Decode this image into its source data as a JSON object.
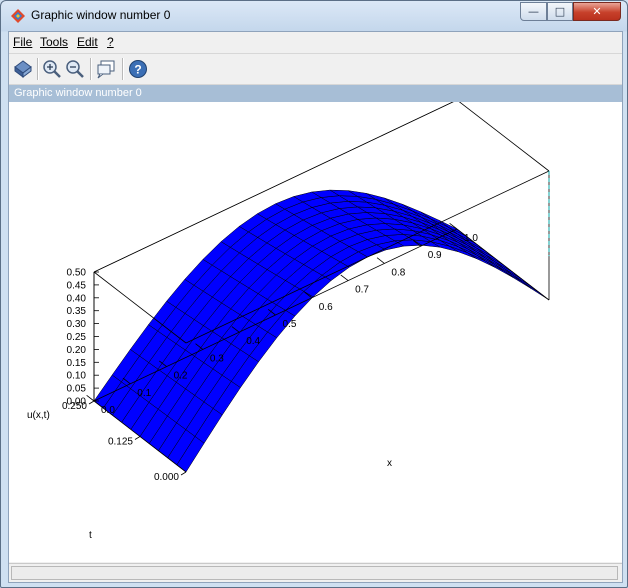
{
  "window": {
    "title": "Graphic window number 0",
    "controls": {
      "minimize": "—",
      "maximize": "□",
      "close": "✕"
    }
  },
  "menu": {
    "file": "File",
    "tools": "Tools",
    "edit": "Edit",
    "help": "?"
  },
  "toolbar": {
    "icons": [
      "rotate-icon",
      "zoom-in-icon",
      "zoom-out-icon",
      "datatip-icon",
      "help-icon"
    ]
  },
  "infobar": {
    "text": "Graphic window number 0"
  },
  "plot": {
    "zlabel": "u(x,t)",
    "xlabel": "x",
    "ylabel": "t",
    "z_ticks": [
      "0.50",
      "0.45",
      "0.40",
      "0.35",
      "0.30",
      "0.25",
      "0.20",
      "0.15",
      "0.10",
      "0.05",
      "0.00"
    ],
    "x_ticks": [
      "0.0",
      "0.1",
      "0.2",
      "0.3",
      "0.4",
      "0.5",
      "0.6",
      "0.7",
      "0.8",
      "0.9",
      "1.0"
    ],
    "t_ticks": [
      "0.000",
      "0.125",
      "0.250"
    ],
    "surface_color": "#0000ff"
  }
}
